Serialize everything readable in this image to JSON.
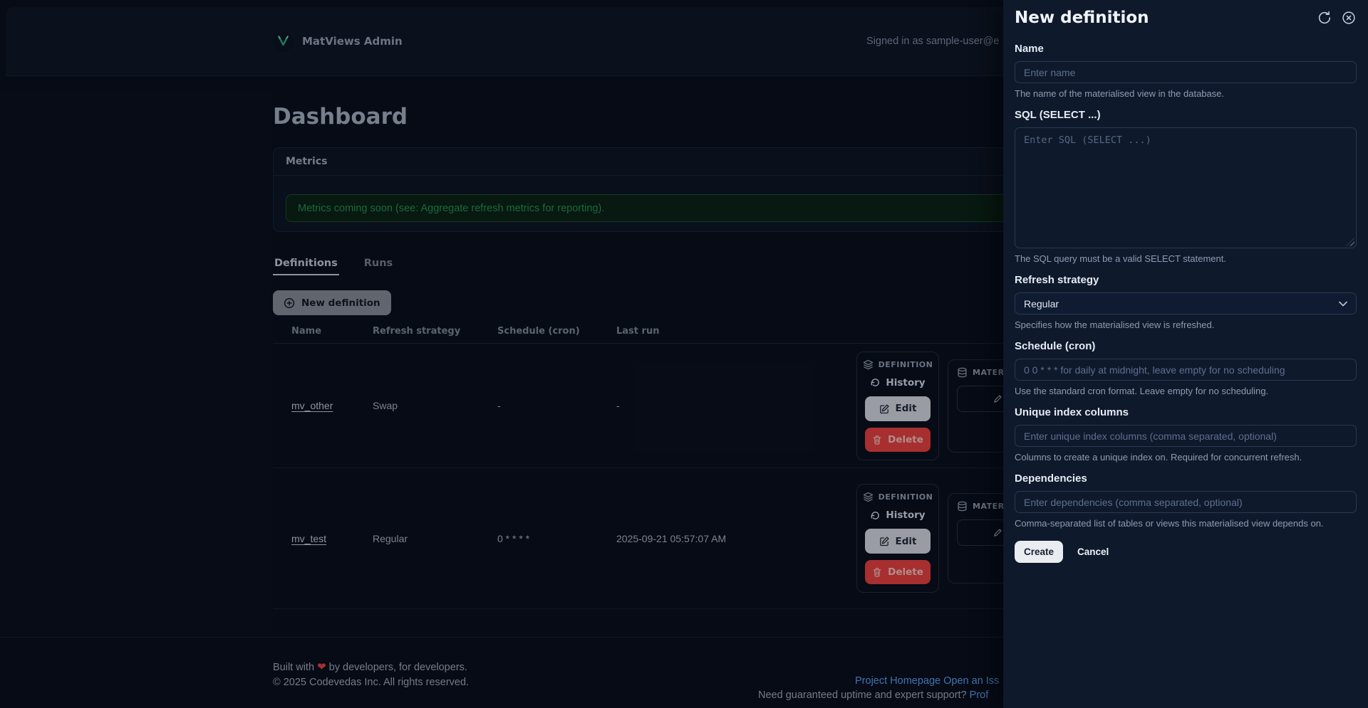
{
  "colors": {
    "accent_teal": "#34d399",
    "link_blue": "#60a5fa",
    "delete_red": "#ef4444",
    "alert_green": "#27955a",
    "panel_bg": "#0e192c"
  },
  "header": {
    "brand": "MatViews Admin",
    "signed_in_text": "Signed in as sample-user@e"
  },
  "page": {
    "title": "Dashboard"
  },
  "metrics": {
    "title": "Metrics",
    "alert_text": "Metrics coming soon (see: Aggregate refresh metrics for reporting)."
  },
  "tabs": {
    "definitions": "Definitions",
    "runs": "Runs"
  },
  "actions_bar": {
    "new_definition": "New definition"
  },
  "table": {
    "headers": {
      "name": "Name",
      "refresh_strategy": "Refresh strategy",
      "schedule": "Schedule (cron)",
      "last_run": "Last run"
    },
    "rows": [
      {
        "name": "mv_other",
        "refresh_strategy": "Swap",
        "schedule": "-",
        "last_run": "-"
      },
      {
        "name": "mv_test",
        "refresh_strategy": "Regular",
        "schedule": "0 * * * *",
        "last_run": "2025-09-21 05:57:07 AM"
      }
    ],
    "actions": {
      "definition_group": "DEFINITION",
      "materialized_group": "MATER",
      "history": "History",
      "edit": "Edit",
      "delete": "Delete"
    }
  },
  "footer": {
    "built_with": "Built with",
    "heart": "❤",
    "built_with_rest": "by developers, for developers.",
    "copyright": "© 2025 Codevedas Inc. All rights reserved.",
    "project_homepage": "Project Homepage",
    "open_issue": "Open an Iss",
    "support_question": "Need guaranteed uptime and expert support?",
    "support_link": "Prof"
  },
  "panel": {
    "title": "New definition",
    "name": {
      "label": "Name",
      "placeholder": "Enter name",
      "help": "The name of the materialised view in the database."
    },
    "sql": {
      "label": "SQL (SELECT ...)",
      "placeholder": "Enter SQL (SELECT ...)",
      "help": "The SQL query must be a valid SELECT statement."
    },
    "refresh_strategy": {
      "label": "Refresh strategy",
      "value": "Regular",
      "help": "Specifies how the materialised view is refreshed."
    },
    "schedule": {
      "label": "Schedule (cron)",
      "placeholder": "0 0 * * * for daily at midnight, leave empty for no scheduling",
      "help": "Use the standard cron format. Leave empty for no scheduling."
    },
    "unique_index": {
      "label": "Unique index columns",
      "placeholder": "Enter unique index columns (comma separated, optional)",
      "help": "Columns to create a unique index on. Required for concurrent refresh."
    },
    "dependencies": {
      "label": "Dependencies",
      "placeholder": "Enter dependencies (comma separated, optional)",
      "help": "Comma-separated list of tables or views this materialised view depends on."
    },
    "buttons": {
      "create": "Create",
      "cancel": "Cancel"
    }
  }
}
